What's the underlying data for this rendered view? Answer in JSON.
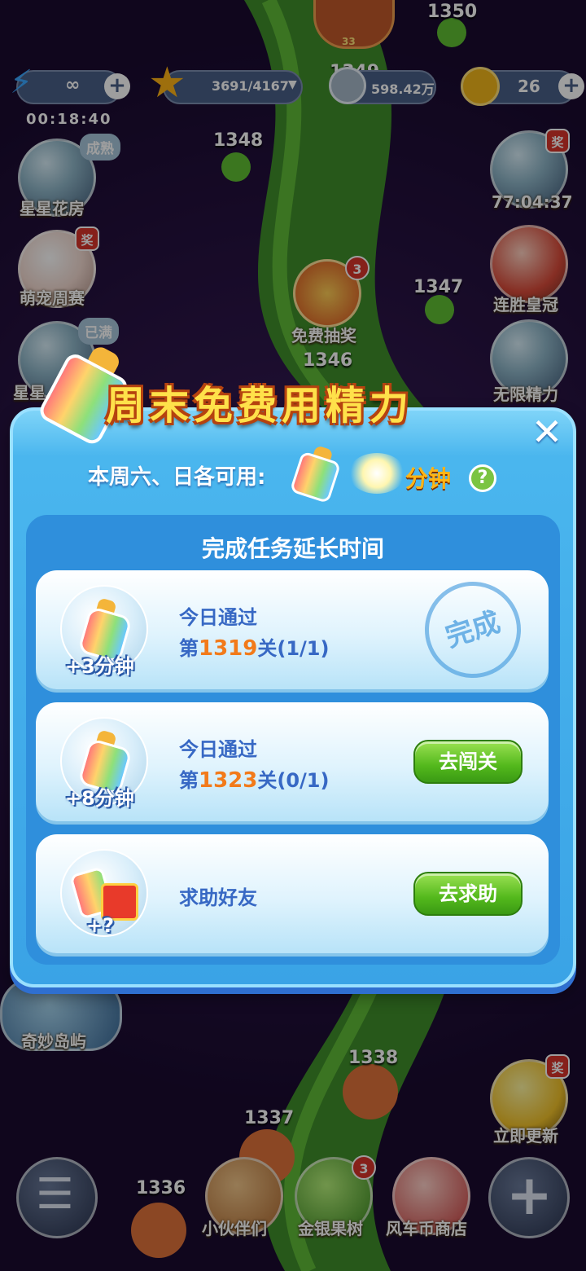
{
  "top_bar": {
    "energy_value": "∞",
    "energy_timer": "00:18:40",
    "stars": "3691/4167",
    "coins": "598.42万",
    "windmill_coins": "26",
    "avatar_level": "33"
  },
  "map_levels": [
    "1350",
    "1349",
    "1348",
    "1347",
    "1346",
    "1338",
    "1337",
    "1336"
  ],
  "free_lottery": {
    "label": "免费抽奖",
    "badge": "3"
  },
  "left_side": [
    {
      "label": "星星花房",
      "tag": "成熟"
    },
    {
      "label": "萌宠周赛",
      "tag": "奖"
    },
    {
      "label": "星星",
      "tag": "已满"
    },
    {
      "label": "奇妙岛屿",
      "tag": ""
    }
  ],
  "right_side": [
    {
      "label": "77:04:37",
      "tag": "奖"
    },
    {
      "label": "连胜皇冠",
      "tag": ""
    },
    {
      "label": "无限精力",
      "tag": ""
    },
    {
      "label": "立即更新",
      "tag": "奖"
    }
  ],
  "bottom_nav": [
    {
      "label": "",
      "icon": "menu-icon"
    },
    {
      "label": "小伙伴们",
      "icon": "raccoon-icon"
    },
    {
      "label": "金银果树",
      "icon": "tree-icon",
      "badge": "3"
    },
    {
      "label": "风车币商店",
      "icon": "shop-icon"
    },
    {
      "label": "",
      "icon": "plus-icon"
    }
  ],
  "dialog": {
    "title": "周末免费用精力",
    "close": "✕",
    "subtitle": "本周六、日各可用:",
    "minutes_label": "分钟",
    "help": "?",
    "section_title": "完成任务延长时间",
    "tasks": [
      {
        "bonus": "+3分钟",
        "line1": "今日通过",
        "prefix": "第",
        "level": "1319",
        "suffix": "关(1/1)",
        "status": "完成"
      },
      {
        "bonus": "+8分钟",
        "line1": "今日通过",
        "prefix": "第",
        "level": "1323",
        "suffix": "关(0/1)",
        "button": "去闯关"
      },
      {
        "bonus": "+?",
        "line1": "求助好友",
        "button": "去求助"
      }
    ]
  }
}
